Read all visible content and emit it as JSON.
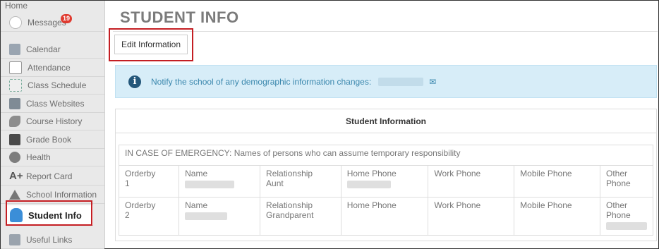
{
  "sidebar": {
    "home": "Home",
    "items": [
      {
        "label": "Messages",
        "icon": "envelope-icon",
        "badge": "19"
      },
      {
        "label": "Calendar",
        "icon": "calendar-icon"
      },
      {
        "label": "Attendance",
        "icon": "checklist-icon"
      },
      {
        "label": "Class Schedule",
        "icon": "schedule-icon"
      },
      {
        "label": "Class Websites",
        "icon": "websites-icon"
      },
      {
        "label": "Course History",
        "icon": "history-icon"
      },
      {
        "label": "Grade Book",
        "icon": "gradebook-icon"
      },
      {
        "label": "Health",
        "icon": "health-icon"
      },
      {
        "label": "Report Card",
        "icon": "report-card-icon",
        "glyph": "A+"
      },
      {
        "label": "School Information",
        "icon": "school-icon"
      },
      {
        "label": "Student Info",
        "icon": "student-icon",
        "active": true
      },
      {
        "label": "Useful Links",
        "icon": "links-icon"
      }
    ]
  },
  "page": {
    "title": "STUDENT INFO",
    "edit_button": "Edit Information"
  },
  "notice": {
    "text": "Notify the school of any demographic information changes:",
    "icon": "info-icon",
    "email_icon": "envelope-icon"
  },
  "panel": {
    "title": "Student Information",
    "emergency_caption": "IN CASE OF EMERGENCY: Names of persons who can assume temporary responsibility",
    "columns": [
      "Orderby",
      "Name",
      "Relationship",
      "Home Phone",
      "Work Phone",
      "Mobile Phone",
      "Other Phone"
    ],
    "rows": [
      {
        "orderby": "1",
        "relationship": "Aunt"
      },
      {
        "orderby": "2",
        "relationship": "Grandparent"
      }
    ]
  },
  "colors": {
    "highlight_box": "#c41e23",
    "notice_bg": "#d7edf8",
    "notice_text": "#3a87ad",
    "badge": "#e03a2f"
  }
}
